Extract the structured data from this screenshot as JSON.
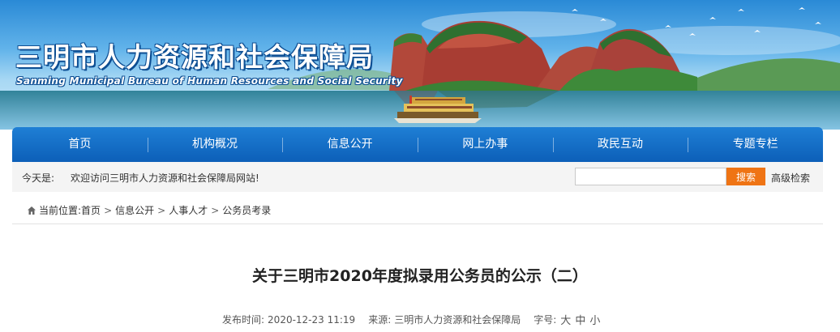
{
  "header": {
    "title": "三明市人力资源和社会保障局",
    "subtitle": "Sanming Municipal Bureau of Human Resources and Social Security"
  },
  "nav": {
    "items": [
      {
        "label": "首页"
      },
      {
        "label": "机构概况"
      },
      {
        "label": "信息公开"
      },
      {
        "label": "网上办事"
      },
      {
        "label": "政民互动"
      },
      {
        "label": "专题专栏"
      }
    ]
  },
  "infobar": {
    "today_label": "今天是:",
    "welcome": "欢迎访问三明市人力资源和社会保障局网站!",
    "search_placeholder": "",
    "search_button": "搜索",
    "advanced_search": "高级检索"
  },
  "breadcrumb": {
    "prefix": "当前位置:",
    "items": [
      "首页",
      "信息公开",
      "人事人才",
      "公务员考录"
    ],
    "separator": ">"
  },
  "article": {
    "title": "关于三明市2020年度拟录用公务员的公示（二）",
    "published_label": "发布时间:",
    "published": "2020-12-23 11:19",
    "source_label": "来源:",
    "source": "三明市人力资源和社会保障局",
    "font_size_label": "字号:",
    "font_large": "大",
    "font_medium": "中",
    "font_small": "小"
  },
  "colors": {
    "nav_blue": "#0c5fb8",
    "search_orange": "#ef7414",
    "title_outline": "#0d4e93"
  },
  "icons": {
    "breadcrumb": "home-icon"
  }
}
